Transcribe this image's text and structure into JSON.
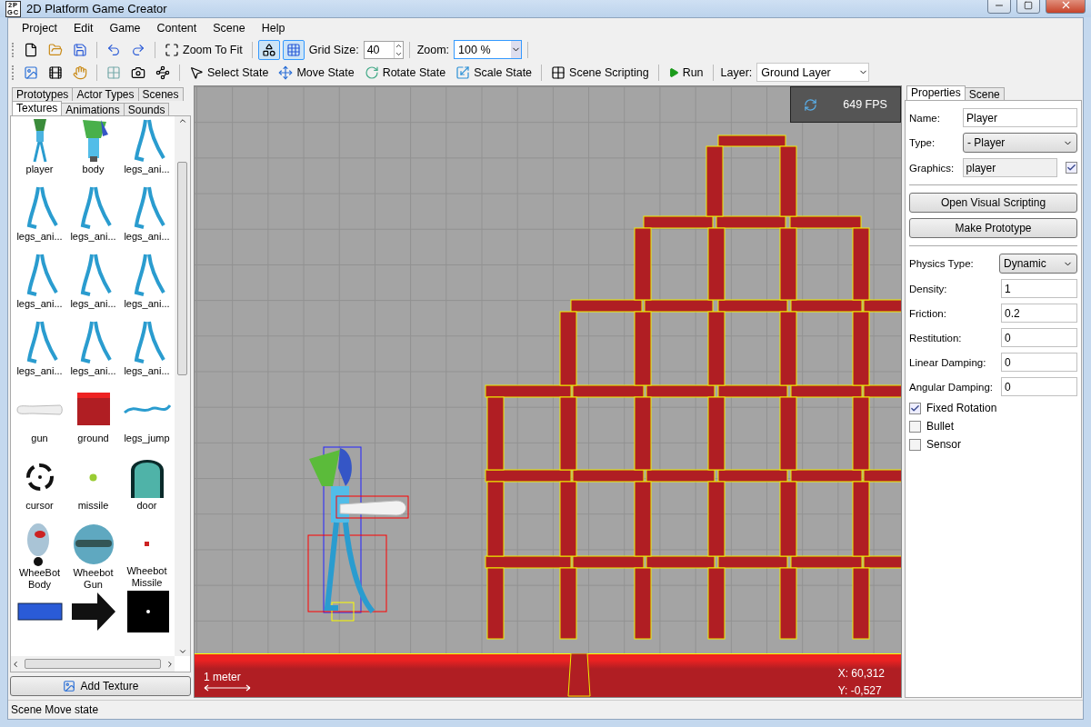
{
  "window": {
    "title": "2D Platform Game Creator",
    "icon_text": [
      "2P",
      "GC"
    ]
  },
  "menu": [
    "Project",
    "Edit",
    "Game",
    "Content",
    "Scene",
    "Help"
  ],
  "toolbar_1": {
    "zoom_to_fit": "Zoom To Fit",
    "toggles": [
      {
        "kind": "shapes",
        "pressed": true
      },
      {
        "kind": "grid",
        "pressed": true
      }
    ],
    "grid_size": {
      "label": "Grid Size:",
      "value": "40"
    },
    "zoom": {
      "label": "Zoom:",
      "value": "100 %"
    }
  },
  "toolbar_2": {
    "states": [
      {
        "kind": "select",
        "label": "Select State"
      },
      {
        "kind": "move",
        "label": "Move State"
      },
      {
        "kind": "rotate",
        "label": "Rotate State"
      },
      {
        "kind": "scale",
        "label": "Scale State"
      }
    ],
    "scripting": "Scene Scripting",
    "run": "Run",
    "layer": {
      "label": "Layer:",
      "value": "Ground Layer"
    }
  },
  "left_panel": {
    "tabs_top": [
      {
        "label": "Prototypes",
        "selected": false
      },
      {
        "label": "Actor Types",
        "selected": false
      },
      {
        "label": "Scenes",
        "selected": false
      }
    ],
    "tabs_bottom": [
      {
        "label": "Textures",
        "selected": true
      },
      {
        "label": "Animations",
        "selected": false
      },
      {
        "label": "Sounds",
        "selected": false
      }
    ],
    "textures": [
      {
        "kind": "character",
        "label": "player"
      },
      {
        "kind": "body",
        "label": "body"
      },
      {
        "kind": "legs",
        "label": "legs_ani..."
      },
      {
        "kind": "legs",
        "label": "legs_ani..."
      },
      {
        "kind": "legs",
        "label": "legs_ani..."
      },
      {
        "kind": "legs",
        "label": "legs_ani..."
      },
      {
        "kind": "legs",
        "label": "legs_ani..."
      },
      {
        "kind": "legs",
        "label": "legs_ani..."
      },
      {
        "kind": "legs",
        "label": "legs_ani..."
      },
      {
        "kind": "legs",
        "label": "legs_ani..."
      },
      {
        "kind": "legs",
        "label": "legs_ani..."
      },
      {
        "kind": "legs",
        "label": "legs_ani..."
      },
      {
        "kind": "gun",
        "label": "gun"
      },
      {
        "kind": "block",
        "label": "ground"
      },
      {
        "kind": "curve",
        "label": "legs_jump"
      },
      {
        "kind": "cursor",
        "label": "cursor"
      },
      {
        "kind": "dot",
        "label": "missile"
      },
      {
        "kind": "door",
        "label": "door"
      },
      {
        "kind": "robot",
        "label": "WheeBot Body"
      },
      {
        "kind": "sphere",
        "label": "Wheebot Gun"
      },
      {
        "kind": "speck",
        "label": "Wheebot Missile"
      },
      {
        "kind": "bar"
      },
      {
        "kind": "arrow"
      },
      {
        "kind": "screen"
      }
    ],
    "add_button": "Add Texture"
  },
  "canvas": {
    "fps": "649 FPS",
    "scale_label": "1 meter",
    "x": "X: 60,312",
    "y": "Y: -0,527"
  },
  "properties": {
    "tabs": [
      {
        "label": "Properties",
        "selected": true
      },
      {
        "label": "Scene",
        "selected": false
      }
    ],
    "name": {
      "label": "Name:",
      "value": "Player"
    },
    "type": {
      "label": "Type:",
      "value": "- Player"
    },
    "graphics": {
      "label": "Graphics:",
      "value": "player",
      "checked": true
    },
    "buttons": [
      "Open Visual Scripting",
      "Make Prototype"
    ],
    "physics_type": {
      "label": "Physics Type:",
      "value": "Dynamic"
    },
    "fields": [
      {
        "label": "Density:",
        "value": "1"
      },
      {
        "label": "Friction:",
        "value": "0.2"
      },
      {
        "label": "Restitution:",
        "value": "0"
      },
      {
        "label": "Linear Damping:",
        "value": "0"
      },
      {
        "label": "Angular Damping:",
        "value": "0"
      }
    ],
    "checkboxes": [
      {
        "label": "Fixed Rotation",
        "checked": true
      },
      {
        "label": "Bullet",
        "checked": false
      },
      {
        "label": "Sensor",
        "checked": false
      }
    ]
  },
  "status_bar": "Scene Move state"
}
